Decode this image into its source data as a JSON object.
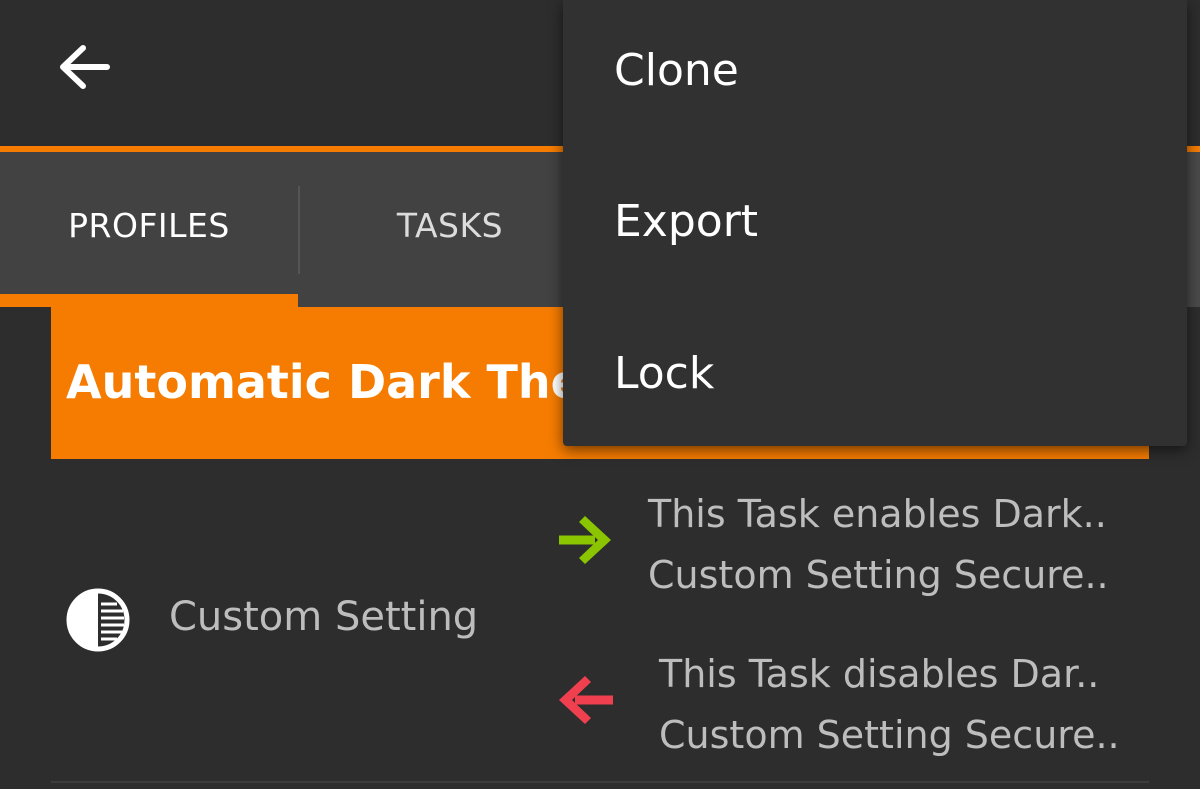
{
  "tabs": {
    "profiles_label": "PROFILES",
    "tasks_label": "TASKS"
  },
  "profile": {
    "title": "Automatic Dark Theme"
  },
  "context": {
    "label": "Custom Setting",
    "enter_task": {
      "line1": "This Task enables Dark..",
      "line2": "Custom Setting Secure.."
    },
    "exit_task": {
      "line1": "This Task disables Dar..",
      "line2": "Custom Setting Secure.."
    }
  },
  "menu": {
    "items": [
      {
        "label": "Clone"
      },
      {
        "label": "Export"
      },
      {
        "label": "Lock"
      }
    ]
  },
  "colors": {
    "accent": "#f57c00",
    "background": "#2d2d2d",
    "tab_bar": "#424242",
    "menu_bg": "#313131",
    "enter_arrow": "#8bc400",
    "exit_arrow": "#f0404f"
  },
  "icons": {
    "back": "arrow-back-icon",
    "context": "contrast-icon",
    "enter": "arrow-right-icon",
    "exit": "arrow-left-icon"
  }
}
